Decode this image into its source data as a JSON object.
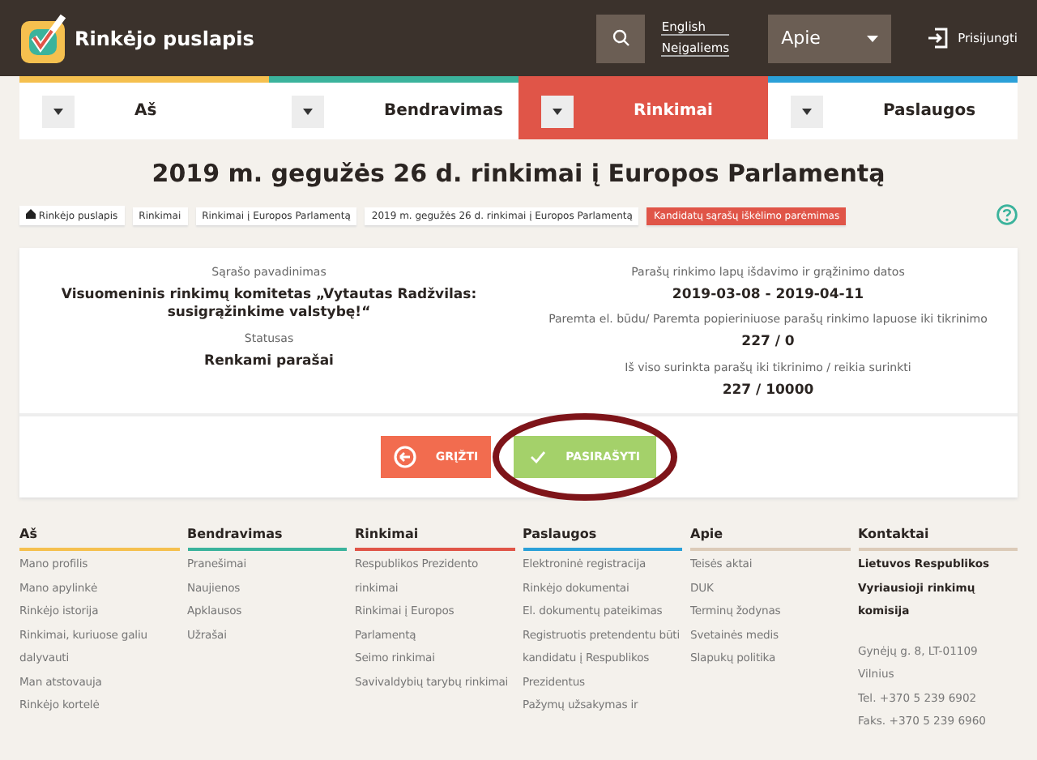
{
  "header": {
    "logo_text": "Rinkėjo puslapis",
    "links": [
      "English",
      "Neįgaliems"
    ],
    "dropdown": "Apie",
    "login": "Prisijungti"
  },
  "nav": [
    {
      "label": "Aš",
      "color": "#f5c04f",
      "selected": false
    },
    {
      "label": "Bendravimas",
      "color": "#3bb39c",
      "selected": false
    },
    {
      "label": "Rinkimai",
      "color": "#e05548",
      "selected": true
    },
    {
      "label": "Paslaugos",
      "color": "#2ba0d8",
      "selected": false
    }
  ],
  "title": "2019 m. gegužės 26 d. rinkimai į Europos Parlamentą",
  "breadcrumbs": [
    {
      "label": "Rinkėjo puslapis",
      "kind": "home"
    },
    {
      "label": "Rinkimai",
      "kind": "link"
    },
    {
      "label": "Rinkimai į Europos Parlamentą",
      "kind": "link"
    },
    {
      "label": "2019 m. gegužės 26 d. rinkimai į Europos Parlamentą",
      "kind": "link"
    },
    {
      "label": "Kandidatų sąrašų iškėlimo parėmimas",
      "kind": "current"
    }
  ],
  "details": {
    "left": [
      {
        "label": "Sąrašo pavadinimas",
        "value": "Visuomeninis rinkimų komitetas „Vytautas Radžvilas: susigrąžinkime valstybę!“"
      },
      {
        "label": "Statusas",
        "value": "Renkami parašai"
      }
    ],
    "right": [
      {
        "label": "Parašų rinkimo lapų išdavimo ir grąžinimo datos",
        "value": "2019-03-08 - 2019-04-11"
      },
      {
        "label": "Paremta el. būdu/ Paremta popieriniuose parašų rinkimo lapuose iki tikrinimo",
        "value": "227 / 0"
      },
      {
        "label": "Iš viso surinkta parašų iki tikrinimo / reikia surinkti",
        "value": "227 / 10000"
      }
    ]
  },
  "actions": [
    {
      "label": "GRĮŽTI",
      "kind": "back",
      "highlighted": false
    },
    {
      "label": "PASIRAŠYTI",
      "kind": "sign",
      "highlighted": true
    }
  ],
  "footer": [
    {
      "heading": "Aš",
      "color": "#f5c04f",
      "kind": "links",
      "links": [
        "Mano profilis",
        "Mano apylinkė",
        "Rinkėjo istorija",
        "Rinkimai, kuriuose galiu dalyvauti",
        "Man atstovauja",
        "Rinkėjo kortelė"
      ]
    },
    {
      "heading": "Bendravimas",
      "color": "#3bb39c",
      "kind": "links",
      "links": [
        "Pranešimai",
        "Naujienos",
        "Apklausos",
        "Užrašai"
      ]
    },
    {
      "heading": "Rinkimai",
      "color": "#e05548",
      "kind": "links",
      "links": [
        "Respublikos Prezidento rinkimai",
        "Rinkimai į Europos Parlamentą",
        "Seimo rinkimai",
        "Savivaldybių tarybų rinkimai"
      ]
    },
    {
      "heading": "Paslaugos",
      "color": "#2ba0d8",
      "kind": "links",
      "links": [
        "Elektroninė registracija",
        "Rinkėjo dokumentai",
        "El. dokumentų pateikimas",
        "Registruotis pretendentu būti kandidatu į Respublikos Prezidentus",
        "Pažymų užsakymas ir"
      ]
    },
    {
      "heading": "Apie",
      "color": "#dccbb8",
      "kind": "links",
      "links": [
        "Teisės aktai",
        "DUK",
        "Terminų žodynas",
        "Svetainės medis",
        "Slapukų politika"
      ]
    },
    {
      "heading": "Kontaktai",
      "color": "#dccbb8",
      "kind": "contact",
      "org": "Lietuvos Respublikos Vyriausioji rinkimų komisija",
      "lines": [
        "Gynėjų g. 8, LT-01109",
        "Vilnius",
        "Tel. +370 5 239 6902",
        "Faks. +370 5 239 6960"
      ]
    }
  ]
}
